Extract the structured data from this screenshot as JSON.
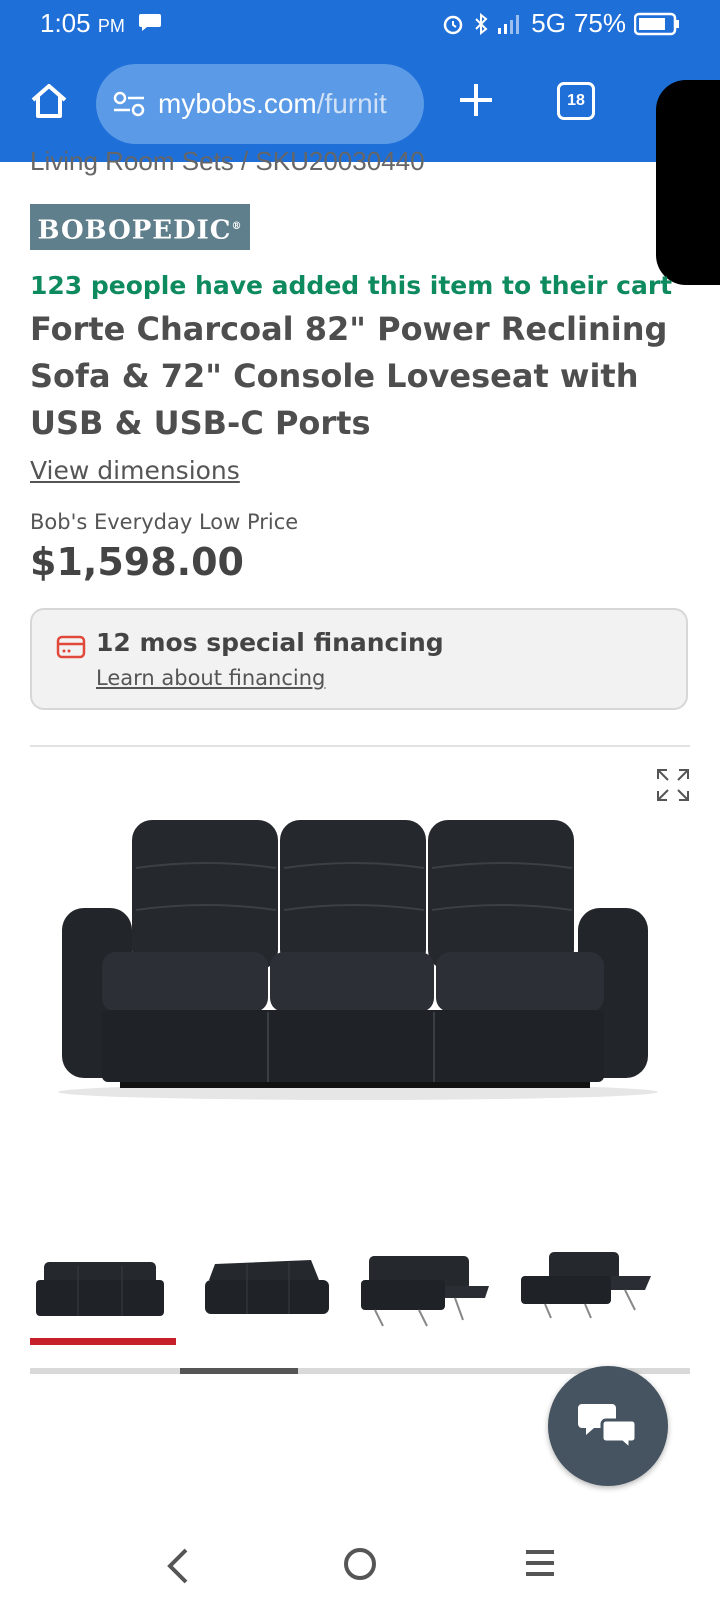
{
  "status_bar": {
    "time": "1:05",
    "ampm": "PM",
    "network": "5G",
    "battery": "75%"
  },
  "browser": {
    "url_domain": "mybobs.com",
    "url_path": "/furnit",
    "tab_count": "18"
  },
  "breadcrumb": "Living Room Sets / SKU20030440",
  "brand": {
    "logo_text": "BOBOPEDIC",
    "logo_mark": "®"
  },
  "product": {
    "social_proof": "123 people have added this item to their cart",
    "title": "Forte Charcoal 82\" Power Reclining Sofa & 72\" Console Loveseat with USB & USB-C Ports",
    "view_dimensions": "View dimensions",
    "price_label": "Bob's Everyday Low Price",
    "price": "$1,598.00"
  },
  "financing": {
    "title": "12 mos special financing",
    "link": "Learn about financing"
  },
  "gallery": {
    "thumbnail_count": 4,
    "selected_index": 0,
    "colors": {
      "accent_red": "#c8202a",
      "social_green": "#0e8a5f",
      "browser_blue": "#1f6fd8"
    }
  }
}
